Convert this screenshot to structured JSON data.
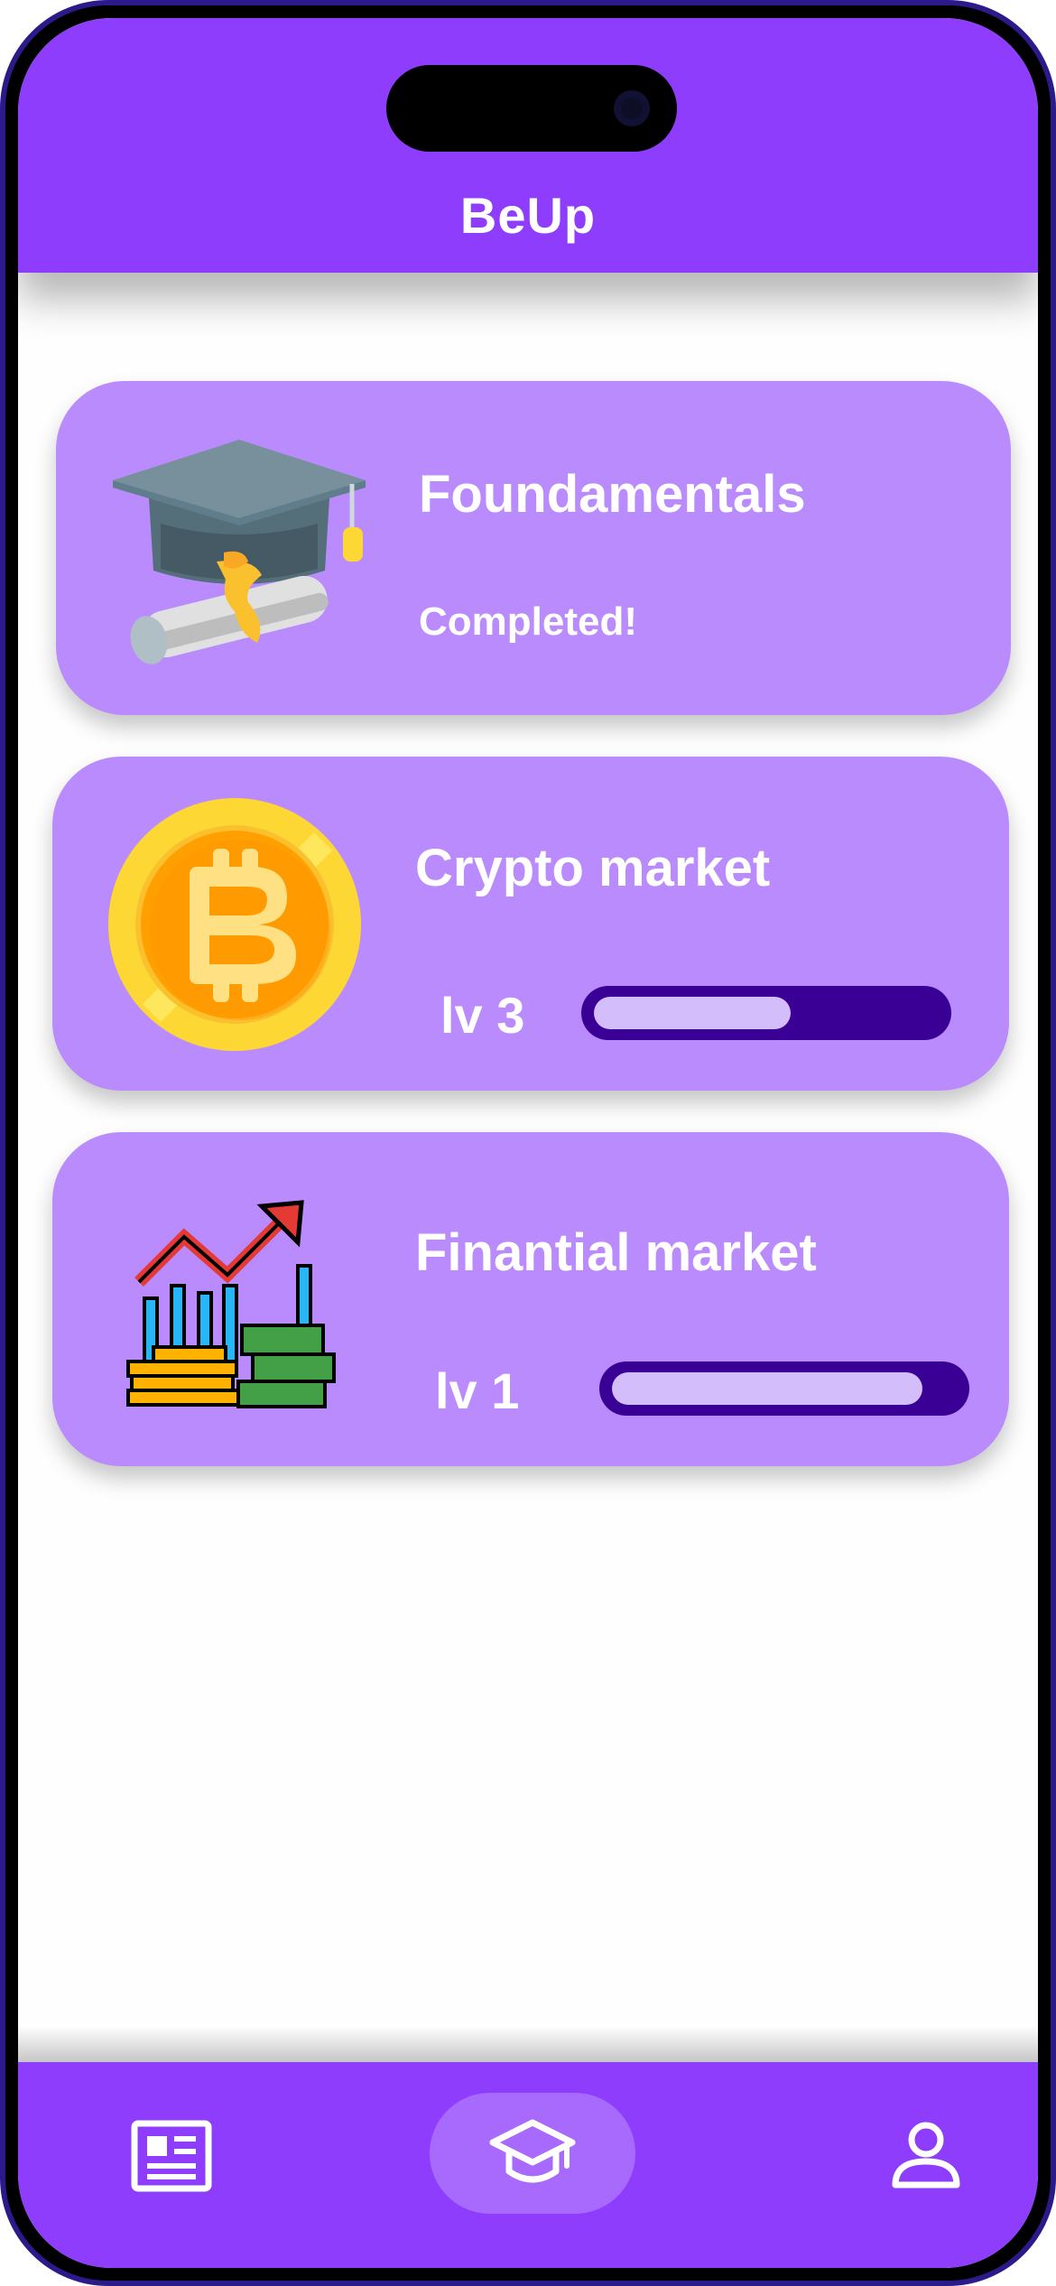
{
  "app": {
    "title": "BeUp"
  },
  "colors": {
    "primary": "#8e3dfd",
    "card": "#b98bfc",
    "bar_track": "#3a0096",
    "bar_fill": "#d4bdfb"
  },
  "courses": [
    {
      "title": "Foundamentals",
      "status": "Completed!",
      "icon": "graduation-cap-diploma-icon"
    },
    {
      "title": "Crypto market",
      "level": "lv 3",
      "progress": 0.57,
      "icon": "bitcoin-coin-icon"
    },
    {
      "title": "Finantial market",
      "level": "lv 1",
      "progress": 0.9,
      "icon": "market-growth-money-icon"
    }
  ],
  "nav": {
    "items": [
      {
        "icon": "news-icon",
        "active": false
      },
      {
        "icon": "graduation-cap-icon",
        "active": true
      },
      {
        "icon": "profile-icon",
        "active": false
      }
    ]
  }
}
